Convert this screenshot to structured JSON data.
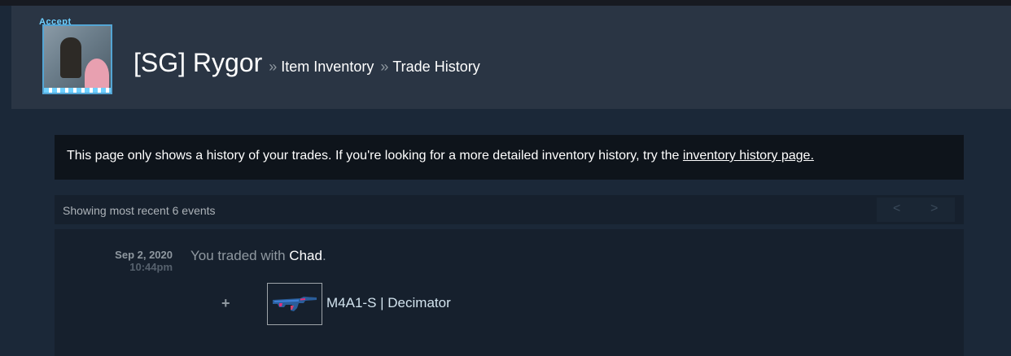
{
  "header": {
    "avatar_tag": "Accept",
    "persona_name": "[SG] Rygor",
    "breadcrumb_sep": "»",
    "breadcrumbs": [
      "Item Inventory",
      "Trade History"
    ]
  },
  "notice": {
    "text": "This page only shows a history of your trades. If you're looking for a more detailed inventory history, try the ",
    "link_text": "inventory history page."
  },
  "events": {
    "count_text": "Showing most recent 6 events",
    "prev_label": "<",
    "next_label": ">"
  },
  "trade": {
    "date": "Sep 2, 2020",
    "time": "10:44pm",
    "desc_prefix": "You traded with ",
    "partner": "Chad",
    "desc_suffix": ".",
    "sign": "+",
    "item_name": "M4A1-S | Decimator"
  },
  "colors": {
    "page_bg": "#1b2838",
    "header_bg": "#2a3544",
    "notice_bg": "#0e141b",
    "accent_rifle": "#3d7fd6",
    "accent_pink": "#e0317a"
  }
}
